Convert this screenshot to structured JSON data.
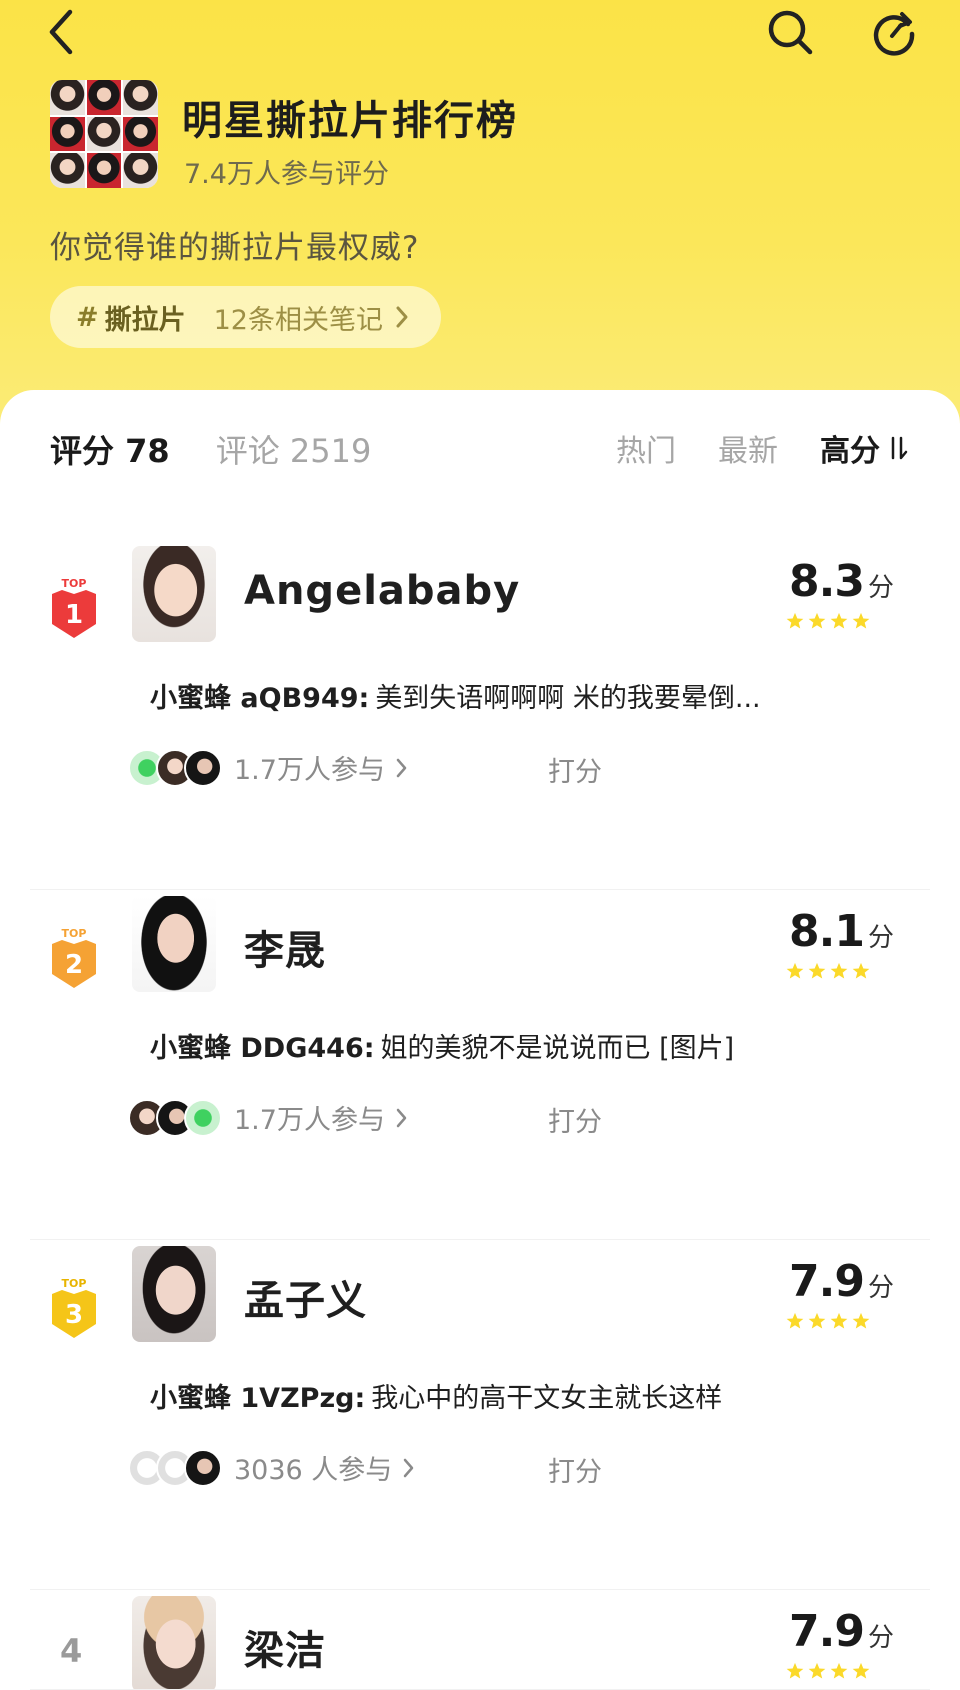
{
  "header": {
    "title": "明星撕拉片排行榜",
    "participants": "7.4万人参与评分",
    "question": "你觉得谁的撕拉片最权威?",
    "tag": {
      "hash": "#",
      "name": "撕拉片",
      "notes": "12条相关笔记"
    }
  },
  "tabs": {
    "rating": "评分 78",
    "comments": "评论 2519"
  },
  "sorts": {
    "hot": "热门",
    "new": "最新",
    "high": "高分"
  },
  "items": [
    {
      "rank": "1",
      "rank_label": "TOP",
      "name": "Angelababy",
      "score": "8.3",
      "unit": "分",
      "stars": 4,
      "comment_user": "小蜜蜂 aQB949:",
      "comment_text": "美到失语啊啊啊 米的我要晕倒...",
      "participants": "1.7万人参与",
      "rate": "打分"
    },
    {
      "rank": "2",
      "rank_label": "TOP",
      "name": "李晟",
      "score": "8.1",
      "unit": "分",
      "stars": 4,
      "comment_user": "小蜜蜂 DDG446:",
      "comment_text": "姐的美貌不是说说而已 [图片]",
      "participants": "1.7万人参与",
      "rate": "打分"
    },
    {
      "rank": "3",
      "rank_label": "TOP",
      "name": "孟子义",
      "score": "7.9",
      "unit": "分",
      "stars": 4,
      "comment_user": "小蜜蜂 1VZPzg:",
      "comment_text": "我心中的高干文女主就长这样",
      "participants": "3036 人参与",
      "rate": "打分"
    },
    {
      "rank": "4",
      "name": "梁洁",
      "score": "7.9",
      "unit": "分",
      "stars": 4
    }
  ],
  "colors": {
    "top1": "#ec3b3b",
    "top2": "#f5a234",
    "top3": "#f5c518",
    "star": "#fbd92a",
    "header": "#fbe347"
  },
  "icons": {
    "back": "chevron-left-icon",
    "search": "search-icon",
    "share": "refresh-share-icon"
  }
}
